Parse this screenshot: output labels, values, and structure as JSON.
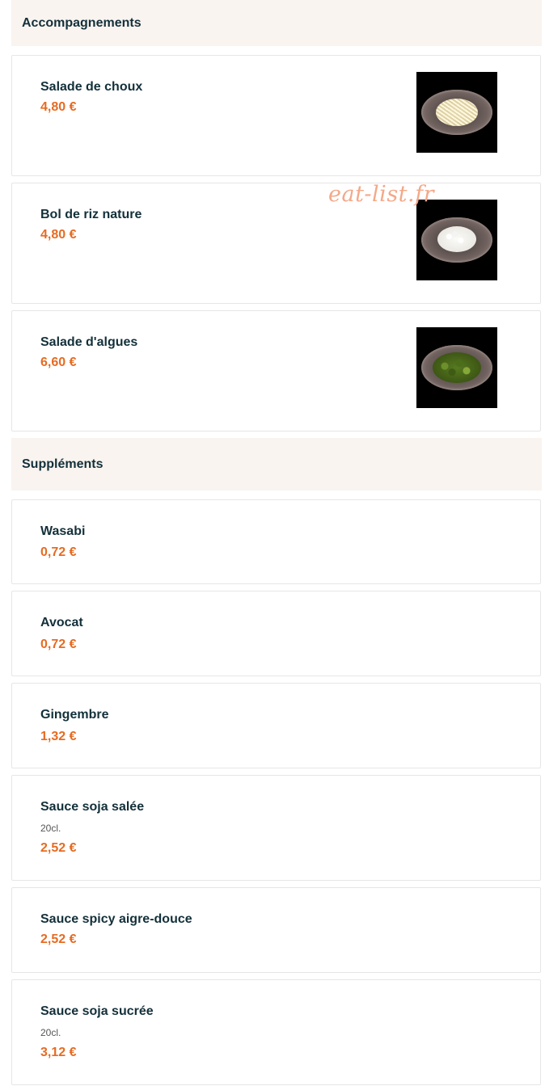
{
  "sections": [
    {
      "title": "Accompagnements",
      "items": [
        {
          "name": "Salade de choux",
          "price": "4,80 €",
          "image": "cabbage-salad-bowl"
        },
        {
          "name": "Bol de riz nature",
          "price": "4,80 €",
          "image": "rice-bowl"
        },
        {
          "name": "Salade d'algues",
          "price": "6,60 €",
          "image": "seaweed-salad-bowl"
        }
      ]
    },
    {
      "title": "Suppléments",
      "items": [
        {
          "name": "Wasabi",
          "price": "0,72 €"
        },
        {
          "name": "Avocat",
          "price": "0,72 €"
        },
        {
          "name": "Gingembre",
          "price": "1,32 €"
        },
        {
          "name": "Sauce soja salée",
          "description": "20cl.",
          "price": "2,52 €"
        },
        {
          "name": "Sauce spicy aigre-douce",
          "price": "2,52 €"
        },
        {
          "name": "Sauce soja sucrée",
          "description": "20cl.",
          "price": "3,12 €"
        }
      ]
    }
  ],
  "watermark": "eat-list.fr",
  "colors": {
    "section_bg": "#f9f4f0",
    "title_text": "#13303a",
    "price_text": "#e66b21",
    "watermark": "#f4a888"
  }
}
